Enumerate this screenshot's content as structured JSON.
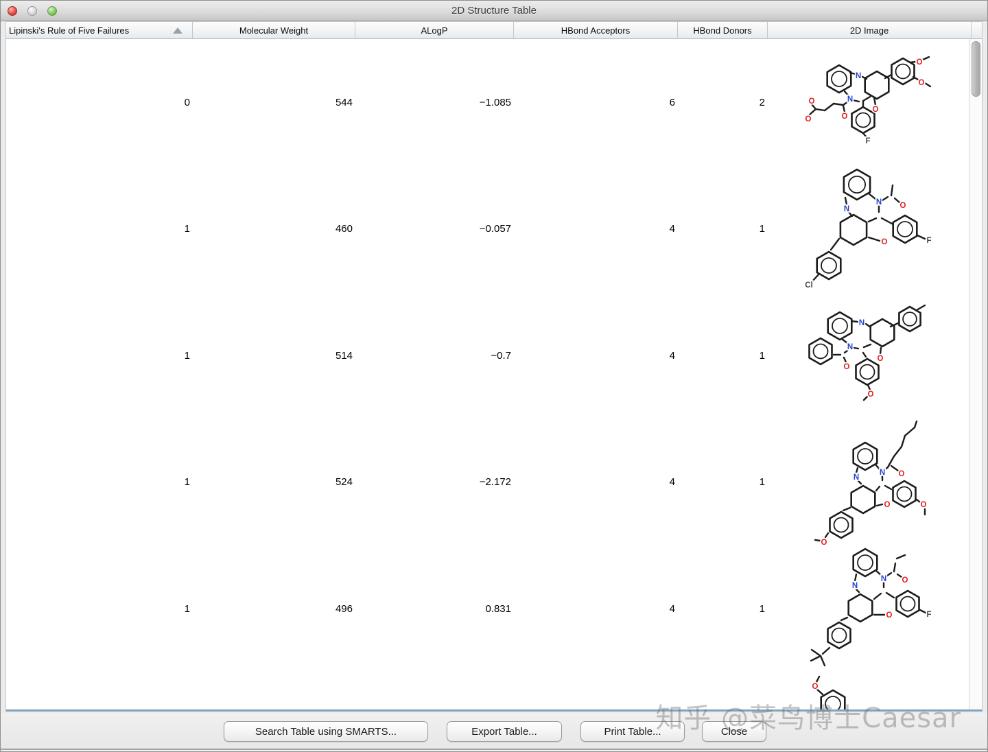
{
  "window": {
    "title": "2D Structure Table"
  },
  "colors": {
    "atom_nitrogen": "#2743cf",
    "atom_oxygen": "#e02020",
    "atom_halogen": "#45494e",
    "pane_border_accent": "#84a3bd"
  },
  "table": {
    "columns": [
      {
        "label": "Lipinski's Rule of Five Failures",
        "sorted_ascending": true
      },
      {
        "label": "Molecular Weight"
      },
      {
        "label": "ALogP"
      },
      {
        "label": "HBond Acceptors"
      },
      {
        "label": "HBond Donors"
      },
      {
        "label": "2D Image"
      }
    ],
    "rows": [
      {
        "lipinski_failures": "0",
        "molecular_weight": "544",
        "alogp": "−1.085",
        "hbond_acceptors": "6",
        "hbond_donors": "2",
        "molecule": {
          "rings": [
            [
              64,
              58,
              20,
              1
            ],
            [
              119,
              67,
              20,
              0
            ],
            [
              157,
              47,
              19,
              1
            ],
            [
              99,
              118,
              19,
              1
            ]
          ],
          "bonds": [
            [
              80,
              49,
              88,
              51
            ],
            [
              96,
              54,
              104,
              58
            ],
            [
              72,
              76,
              78,
              83
            ],
            [
              84,
              89,
              93,
              91
            ],
            [
              99,
              90,
              109,
              84
            ],
            [
              99,
              90,
              99,
              99
            ],
            [
              77,
              91,
              70,
              96
            ],
            [
              70,
              96,
              56,
              94
            ],
            [
              56,
              94,
              43,
              104
            ],
            [
              43,
              104,
              30,
              102
            ],
            [
              70,
              97,
              72,
              106
            ],
            [
              30,
              102,
              24,
              95
            ],
            [
              30,
              102,
              20,
              111
            ],
            [
              115,
              85,
              117,
              96
            ],
            [
              131,
              57,
              140,
              52
            ],
            [
              168,
              34,
              175,
              33
            ],
            [
              186,
              30,
              195,
              26
            ],
            [
              172,
              55,
              179,
              59
            ],
            [
              189,
              64,
              197,
              69
            ],
            [
              99,
              137,
              103,
              142
            ]
          ],
          "labels": [
            [
              92,
              53,
              "N",
              "n"
            ],
            [
              80,
              87,
              "N",
              "n"
            ],
            [
              117,
              102,
              "O",
              "o"
            ],
            [
              72,
              112,
              "O",
              "o"
            ],
            [
              24,
              90,
              "O",
              "o"
            ],
            [
              19,
              116,
              "O",
              "o"
            ],
            [
              181,
              33,
              "O",
              "o"
            ],
            [
              184,
              63,
              "O",
              "o"
            ],
            [
              106,
              148,
              "F",
              "x"
            ]
          ]
        }
      },
      {
        "lipinski_failures": "1",
        "molecular_weight": "460",
        "alogp": "−0.057",
        "hbond_acceptors": "4",
        "hbond_donors": "1",
        "molecule": {
          "rings": [
            [
              90,
              27,
              22,
              1
            ],
            [
              85,
              93,
              22,
              0
            ],
            [
              160,
              92,
              20,
              1
            ],
            [
              49,
              145,
              20,
              1
            ]
          ],
          "bonds": [
            [
              107,
              40,
              117,
              48
            ],
            [
              127,
              50,
              135,
              45
            ],
            [
              140,
              43,
              142,
              28
            ],
            [
              145,
              47,
              152,
              53
            ],
            [
              73,
              46,
              75,
              56
            ],
            [
              78,
              67,
              83,
              73
            ],
            [
              122,
              58,
              122,
              67
            ],
            [
              126,
              76,
              141,
              84
            ],
            [
              118,
              76,
              107,
              81
            ],
            [
              107,
              104,
              123,
              109
            ],
            [
              178,
              101,
              189,
              106
            ],
            [
              64,
              106,
              52,
              122
            ],
            [
              35,
              157,
              25,
              168
            ]
          ],
          "labels": [
            [
              122,
              52,
              "N",
              "n"
            ],
            [
              75,
              62,
              "N",
              "n"
            ],
            [
              157,
              57,
              "O",
              "o"
            ],
            [
              130,
              110,
              "O",
              "o"
            ],
            [
              195,
              108,
              "F",
              "x"
            ],
            [
              20,
              173,
              "Cl",
              "x"
            ]
          ]
        }
      },
      {
        "lipinski_failures": "1",
        "molecular_weight": "514",
        "alogp": "−0.7",
        "hbond_acceptors": "4",
        "hbond_donors": "1",
        "molecule": {
          "rings": [
            [
              65,
              49,
              20,
              1
            ],
            [
              127,
              59,
              20,
              0
            ],
            [
              167,
              39,
              18,
              1
            ],
            [
              37,
              86,
              19,
              1
            ],
            [
              105,
              116,
              19,
              1
            ]
          ],
          "bonds": [
            [
              82,
              42,
              91,
              43
            ],
            [
              103,
              46,
              110,
              51
            ],
            [
              68,
              68,
              76,
              74
            ],
            [
              76,
              85,
              72,
              88
            ],
            [
              71,
              95,
              74,
              102
            ],
            [
              66,
              91,
              56,
              91
            ],
            [
              86,
              81,
              92,
              82
            ],
            [
              100,
              80,
              110,
              76
            ],
            [
              99,
              88,
              103,
              94
            ],
            [
              125,
              81,
              124,
              90
            ],
            [
              139,
              50,
              150,
              45
            ],
            [
              177,
              26,
              189,
              19
            ],
            [
              106,
              135,
              109,
              142
            ],
            [
              105,
              152,
              100,
              157
            ]
          ],
          "labels": [
            [
              97,
              44,
              "N",
              "n"
            ],
            [
              80,
              79,
              "N",
              "n"
            ],
            [
              75,
              108,
              "O",
              "o"
            ],
            [
              124,
              96,
              "O",
              "o"
            ],
            [
              110,
              148,
              "O",
              "o"
            ]
          ]
        }
      },
      {
        "lipinski_failures": "1",
        "molecular_weight": "524",
        "alogp": "−2.172",
        "hbond_acceptors": "4",
        "hbond_donors": "1",
        "molecule": {
          "rings": [
            [
              102,
              54,
              20,
              1
            ],
            [
              99,
              117,
              20,
              0
            ],
            [
              159,
              109,
              19,
              1
            ],
            [
              67,
              154,
              19,
              1
            ]
          ],
          "bonds": [
            [
              117,
              66,
              123,
              73
            ],
            [
              131,
              73,
              135,
              70
            ],
            [
              135,
              70,
              144,
              54
            ],
            [
              144,
              54,
              155,
              40
            ],
            [
              155,
              40,
              160,
              24
            ],
            [
              160,
              24,
              174,
              12
            ],
            [
              174,
              12,
              177,
              3
            ],
            [
              140,
              68,
              150,
              75
            ],
            [
              91,
              71,
              89,
              78
            ],
            [
              92,
              90,
              96,
              94
            ],
            [
              127,
              83,
              127,
              89
            ],
            [
              131,
              97,
              140,
              102
            ],
            [
              123,
              98,
              118,
              104
            ],
            [
              119,
              126,
              127,
              124
            ],
            [
              177,
              117,
              182,
              121
            ],
            [
              189,
              131,
              189,
              139
            ],
            [
              80,
              129,
              70,
              133
            ],
            [
              48,
              166,
              44,
              172
            ],
            [
              36,
              177,
              29,
              176
            ]
          ],
          "labels": [
            [
              127,
              77,
              "N",
              "n"
            ],
            [
              89,
              84,
              "N",
              "n"
            ],
            [
              155,
              79,
              "O",
              "o"
            ],
            [
              134,
              124,
              "O",
              "o"
            ],
            [
              187,
              124,
              "O",
              "o"
            ],
            [
              42,
              179,
              "O",
              "o"
            ]
          ]
        }
      },
      {
        "lipinski_failures": "1",
        "molecular_weight": "496",
        "alogp": "0.831",
        "hbond_acceptors": "4",
        "hbond_donors": "1",
        "molecule": {
          "rings": [
            [
              102,
              25,
              20,
              1
            ],
            [
              95,
              91,
              20,
              0
            ],
            [
              164,
              85,
              19,
              1
            ],
            [
              64,
              131,
              19,
              1
            ]
          ],
          "bonds": [
            [
              118,
              37,
              125,
              43
            ],
            [
              134,
              44,
              140,
              40
            ],
            [
              144,
              38,
              146,
              26
            ],
            [
              148,
              19,
              160,
              14
            ],
            [
              149,
              42,
              155,
              46
            ],
            [
              89,
              42,
              87,
              52
            ],
            [
              89,
              64,
              93,
              68
            ],
            [
              129,
              54,
              129,
              61
            ],
            [
              133,
              69,
              144,
              76
            ],
            [
              125,
              70,
              115,
              78
            ],
            [
              115,
              101,
              130,
              101
            ],
            [
              182,
              94,
              190,
              98
            ],
            [
              76,
              105,
              67,
              109
            ],
            [
              50,
              149,
              40,
              158
            ],
            [
              37,
              161,
              24,
              152
            ],
            [
              37,
              161,
              23,
              168
            ],
            [
              37,
              161,
              43,
              175
            ]
          ],
          "labels": [
            [
              129,
              48,
              "N",
              "n"
            ],
            [
              87,
              58,
              "N",
              "n"
            ],
            [
              160,
              50,
              "O",
              "o"
            ],
            [
              137,
              101,
              "O",
              "o"
            ],
            [
              195,
              100,
              "F",
              "x"
            ]
          ]
        }
      }
    ],
    "partial_row": {
      "molecule": {
        "rings": [
          [
            55,
            46,
            20,
            1
          ]
        ],
        "bonds": [
          [
            35,
            6,
            31,
            14
          ],
          [
            31,
            24,
            40,
            32
          ]
        ],
        "labels": [
          [
            29,
            20,
            "O",
            "o"
          ]
        ]
      }
    }
  },
  "buttons": {
    "search_smarts": "Search Table using SMARTS...",
    "export": "Export Table...",
    "print": "Print Table...",
    "close": "Close"
  },
  "watermark": "知乎 @菜鸟博士Caesar"
}
